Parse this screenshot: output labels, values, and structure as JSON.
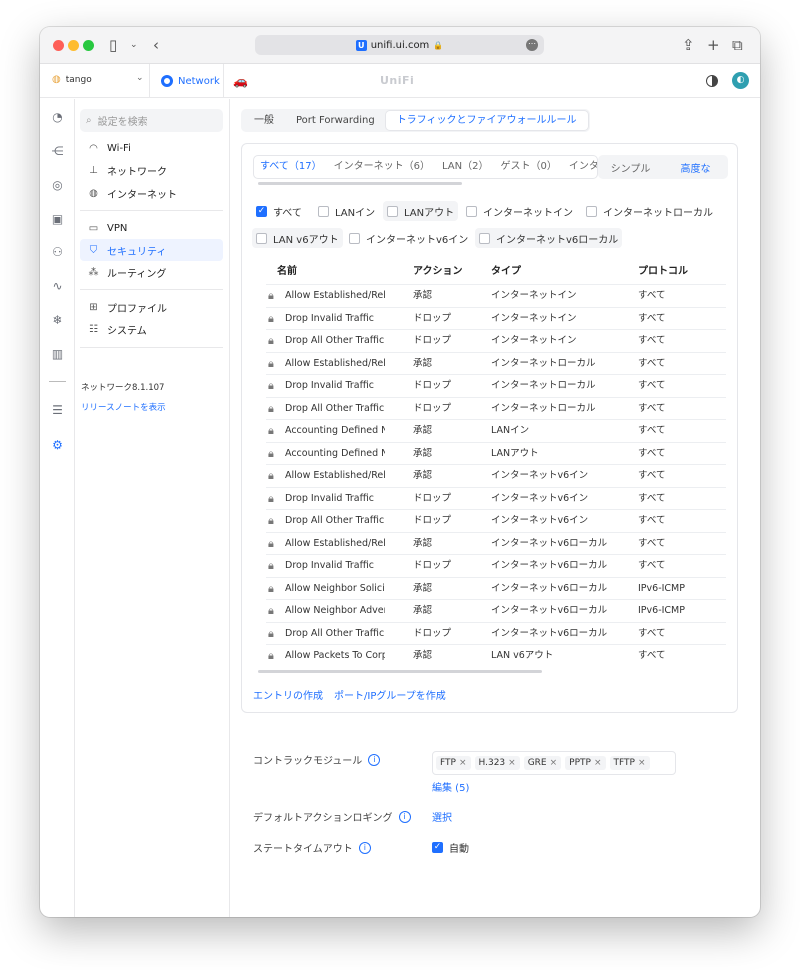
{
  "browser": {
    "url": "unifi.ui.com",
    "favicon": "U"
  },
  "appbar": {
    "site_name": "tango",
    "app_tab": "Network",
    "brand": "UniFi"
  },
  "rail_icons": [
    "dashboard-icon",
    "topology-icon",
    "devices-icon",
    "clients-icon",
    "insights-icon",
    "statistics-icon",
    "integrations-icon",
    "reports-icon",
    "logs-icon",
    "settings-icon"
  ],
  "sidebar": {
    "search_placeholder": "設定を検索",
    "items": [
      {
        "label": "Wi-Fi",
        "icon": "wifi-icon"
      },
      {
        "label": "ネットワーク",
        "icon": "network-icon"
      },
      {
        "label": "インターネット",
        "icon": "globe-icon"
      },
      {
        "label": "VPN",
        "icon": "vpn-icon"
      },
      {
        "label": "セキュリティ",
        "icon": "shield-icon"
      },
      {
        "label": "ルーティング",
        "icon": "routing-icon"
      },
      {
        "label": "プロファイル",
        "icon": "profiles-icon"
      },
      {
        "label": "システム",
        "icon": "system-icon"
      }
    ],
    "version": "ネットワーク8.1.107",
    "release_notes": "リリースノートを表示"
  },
  "top_tabs": [
    "一般",
    "Port Forwarding",
    "トラフィックとファイアウォールルール"
  ],
  "sub_tabs": [
    "すべて（17）",
    "インターネット（6）",
    "LAN（2）",
    "ゲスト（0）",
    "インター"
  ],
  "modes": [
    "シンプル",
    "高度な"
  ],
  "filters": [
    {
      "label": "すべて",
      "checked": true
    },
    {
      "label": "LANイン",
      "checked": false
    },
    {
      "label": "LANアウト",
      "checked": false
    },
    {
      "label": "インターネットイン",
      "checked": false
    },
    {
      "label": "インターネットローカル",
      "checked": false
    },
    {
      "label": "LAN v6アウト",
      "checked": false
    },
    {
      "label": "インターネットv6イン",
      "checked": false
    },
    {
      "label": "インターネットv6ローカル",
      "checked": false
    }
  ],
  "table": {
    "headers": [
      "名前",
      "アクション",
      "タイプ",
      "プロトコル"
    ],
    "rows": [
      [
        "Allow Established/Related Traffic",
        "承認",
        "インターネットイン",
        "すべて"
      ],
      [
        "Drop Invalid Traffic",
        "ドロップ",
        "インターネットイン",
        "すべて"
      ],
      [
        "Drop All Other Traffic",
        "ドロップ",
        "インターネットイン",
        "すべて"
      ],
      [
        "Allow Established/Related Traffic",
        "承認",
        "インターネットローカル",
        "すべて"
      ],
      [
        "Drop Invalid Traffic",
        "ドロップ",
        "インターネットローカル",
        "すべて"
      ],
      [
        "Drop All Other Traffic",
        "ドロップ",
        "インターネットローカル",
        "すべて"
      ],
      [
        "Accounting Defined Network",
        "承認",
        "LANイン",
        "すべて"
      ],
      [
        "Accounting Defined Network",
        "承認",
        "LANアウト",
        "すべて"
      ],
      [
        "Allow Established/Related Traffic",
        "承認",
        "インターネットv6イン",
        "すべて"
      ],
      [
        "Drop Invalid Traffic",
        "ドロップ",
        "インターネットv6イン",
        "すべて"
      ],
      [
        "Drop All Other Traffic",
        "ドロップ",
        "インターネットv6イン",
        "すべて"
      ],
      [
        "Allow Established/Related Traffic",
        "承認",
        "インターネットv6ローカル",
        "すべて"
      ],
      [
        "Drop Invalid Traffic",
        "ドロップ",
        "インターネットv6ローカル",
        "すべて"
      ],
      [
        "Allow Neighbor Solicitation",
        "承認",
        "インターネットv6ローカル",
        "IPv6-ICMP"
      ],
      [
        "Allow Neighbor Advertisement",
        "承認",
        "インターネットv6ローカル",
        "IPv6-ICMP"
      ],
      [
        "Drop All Other Traffic",
        "ドロップ",
        "インターネットv6ローカル",
        "すべて"
      ],
      [
        "Allow Packets To Corporate",
        "承認",
        "LAN v6アウト",
        "すべて"
      ]
    ]
  },
  "links": [
    "エントリの作成",
    "ポート/IPグループを作成"
  ],
  "settings": {
    "conntrack_label": "コントラックモジュール",
    "modules": [
      "FTP",
      "H.323",
      "GRE",
      "PPTP",
      "TFTP"
    ],
    "edit_label": "編集 (5)",
    "logging_label": "デフォルトアクションロギング",
    "logging_value": "選択",
    "timeout_label": "ステートタイムアウト",
    "timeout_value": "自動",
    "info_glyph": "i",
    "remove_glyph": "×"
  },
  "colors": {
    "accent": "#1f6fff"
  }
}
